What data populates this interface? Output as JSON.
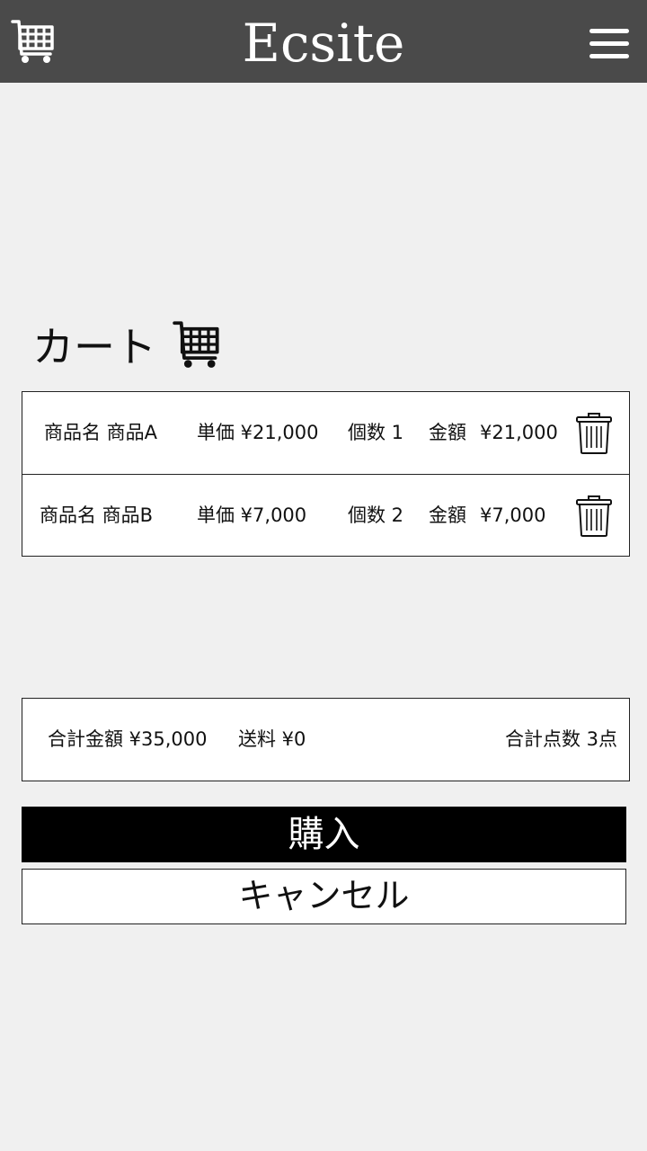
{
  "header": {
    "title": "Ecsite",
    "cart_icon": "cart-icon",
    "menu_icon": "hamburger-menu-icon",
    "background": "#4a4a4a"
  },
  "cart_section": {
    "title": "カート",
    "icon": "cart-icon"
  },
  "cart_items": [
    {
      "name_label": "商品名 商品A",
      "unit_price_label": "単価 ¥21,000",
      "quantity_label": "個数 1",
      "amount_label": "金額",
      "amount_value": "¥21,000",
      "delete_icon": "trash-icon"
    },
    {
      "name_label": "商品名 商品B",
      "unit_price_label": "単価 ¥7,000",
      "quantity_label": "個数 2",
      "amount_label": "金額",
      "amount_value": "¥7,000",
      "delete_icon": "trash-icon"
    }
  ],
  "summary": {
    "total_amount": "合計金額 ¥35,000",
    "shipping": "送料 ¥0",
    "total_count": "合計点数 3点"
  },
  "actions": {
    "buy_label": "購入",
    "cancel_label": "キャンセル"
  }
}
